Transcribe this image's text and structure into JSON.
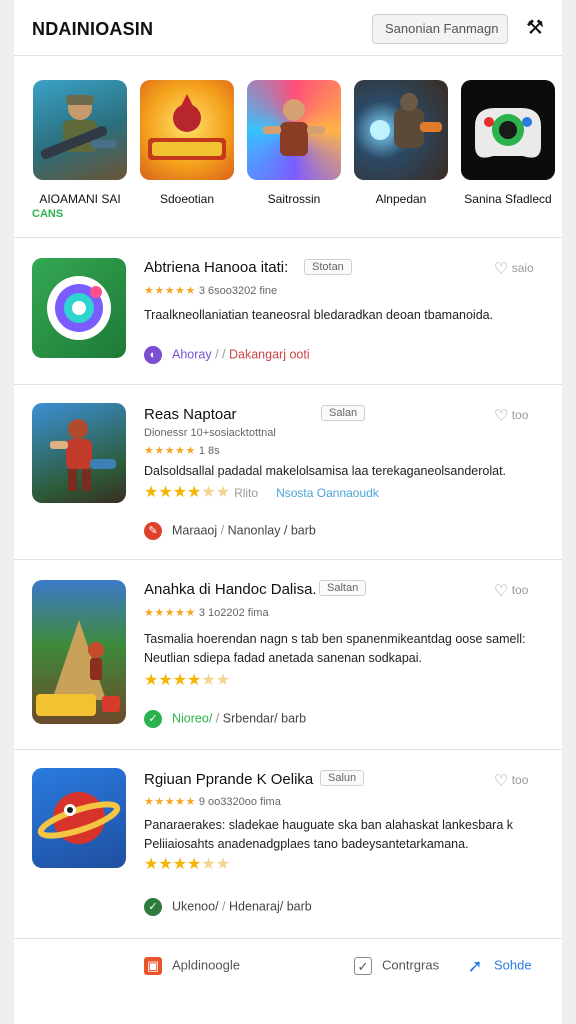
{
  "header": {
    "brand": "NDAINIOASIN",
    "search_placeholder": "Sanonian Fanmagn"
  },
  "featured": [
    {
      "name": "AIOAMANI SAI",
      "sub": "CANS"
    },
    {
      "name": "Sdoeotian",
      "sub": ""
    },
    {
      "name": "Saitrossin",
      "sub": ""
    },
    {
      "name": "Alnpedan",
      "sub": ""
    },
    {
      "name": "Sanina Sfadlecd",
      "sub": ""
    }
  ],
  "list": [
    {
      "title": "Abtriena Hanooa itati:",
      "tag": "Stotan",
      "right": "saio",
      "meta_rating": "3 6soo3202 fine",
      "desc": "Traalkneollaniatian teaneosral bledaradkan deoan tbamanoida.",
      "stars_label": "",
      "link": "",
      "foot_a": "Ahoray",
      "foot_b": "Dakangarj ooti",
      "foot_color": "#7a4fd0"
    },
    {
      "title": "Reas Naptoar",
      "tag": "Salan",
      "right": "too",
      "meta_rating": "Dionessr 10+sosiacktottnal",
      "meta_rating2": "1 8s",
      "desc": "Dalsoldsallal padadal makelolsamisa laa terekaganeolsanderolat.",
      "stars_label": "Rlito",
      "link": "Nsosta Oannaoudk",
      "foot_a": "Maraaoj",
      "foot_b": "Nanonlay / barb",
      "foot_color": "#e0402a"
    },
    {
      "title": "Anahka di Handoc Dalisa.",
      "tag": "Saltan",
      "right": "too",
      "meta_rating": "3 1o2202 fima",
      "desc": "Tasmalia hoerendan nagn s tab ben spanenmikeantdag oose samell: Neutlian sdiepa fadad anetada sanenan sodkapai.",
      "stars_label": "",
      "link": "",
      "foot_a": "Nioreo/",
      "foot_b": "Srbendar/ barb",
      "foot_color": "#2bb24c"
    },
    {
      "title": "Rgiuan Pprande K Oelika",
      "tag": "Salun",
      "right": "too",
      "meta_rating": "9 oo3320oo fima",
      "desc": "Panaraerakes: sladekae hauguate ska ban alahaskat lankesbara k Peliiaiosahts anadenadgplaes tano badeysantetarkamana.",
      "stars_label": "",
      "link": "",
      "foot_a": "Ukenoo/",
      "foot_b": "Hdenaraj/ barb",
      "foot_color": "#2f7a3d"
    }
  ],
  "bottom": {
    "a": "Apldinoogle",
    "b": "Contrgras",
    "c": "Sohde"
  }
}
